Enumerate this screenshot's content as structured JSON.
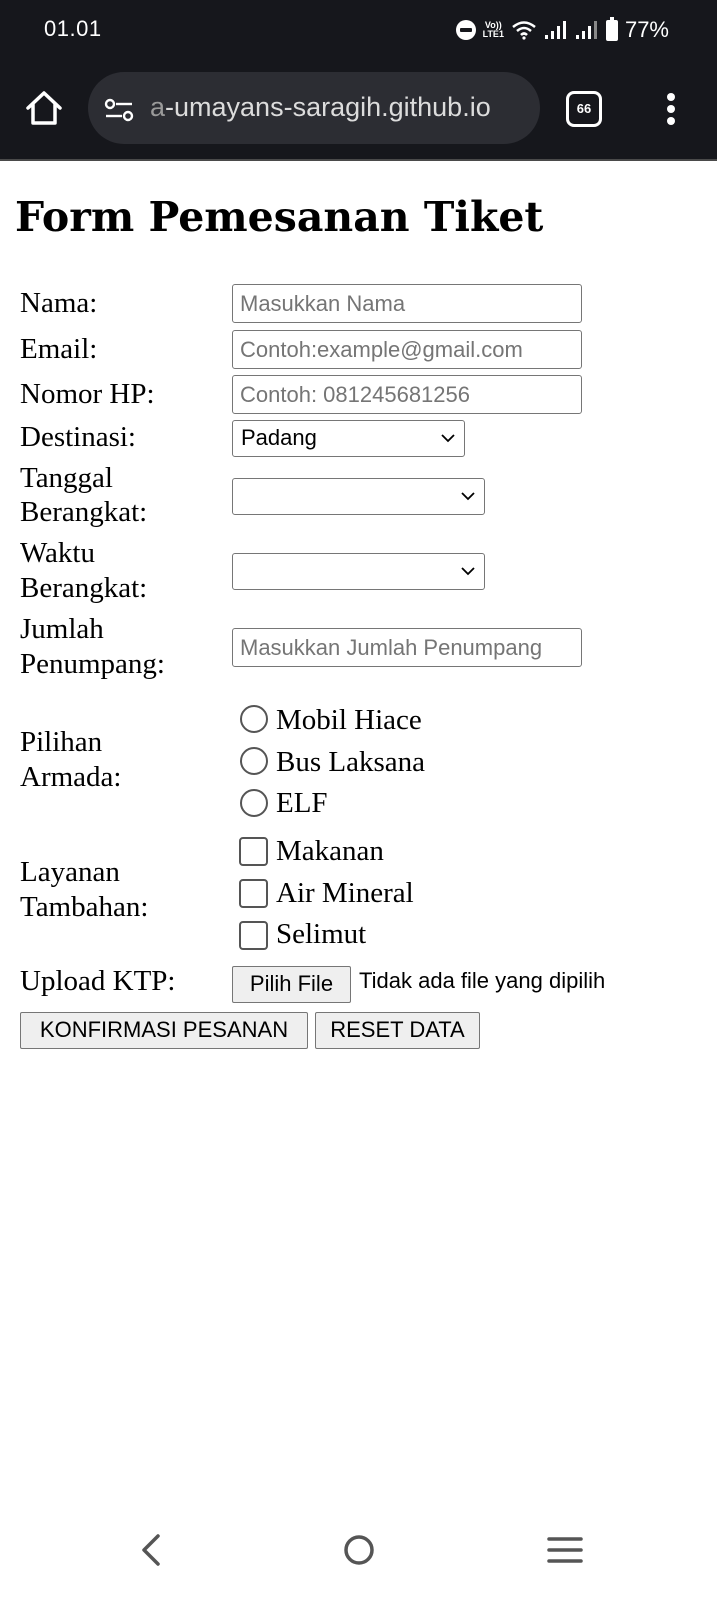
{
  "status_bar": {
    "time": "01.01",
    "volte_line1": "Vo))",
    "volte_line2": "LTE1",
    "battery": "77%",
    "icons": [
      "do-not-disturb-icon",
      "volte-icon",
      "wifi-icon",
      "signal-icon",
      "signal-icon",
      "battery-icon"
    ]
  },
  "browser": {
    "url_faded": "a",
    "url_main": "-umayans-saragih.github.io",
    "tab_count": "66",
    "icons": [
      "home-icon",
      "site-settings-icon",
      "more-options-icon"
    ]
  },
  "form": {
    "title": "Form Pemesanan Tiket",
    "labels": {
      "nama": "Nama:",
      "email": "Email:",
      "nomor_hp": "Nomor HP:",
      "destinasi": "Destinasi:",
      "tanggal_1": "Tanggal",
      "tanggal_2": "Berangkat:",
      "waktu_1": "Waktu",
      "waktu_2": "Berangkat:",
      "jumlah_1": "Jumlah",
      "jumlah_2": "Penumpang:",
      "armada_1": "Pilihan",
      "armada_2": "Armada:",
      "layanan_1": "Layanan",
      "layanan_2": "Tambahan:",
      "upload": "Upload KTP:"
    },
    "placeholders": {
      "nama": "Masukkan Nama",
      "email": "Contoh:example@gmail.com",
      "nomor_hp": "Contoh: 081245681256",
      "jumlah": "Masukkan Jumlah Penumpang"
    },
    "values": {
      "nama": "",
      "email": "",
      "nomor_hp": "",
      "jumlah": ""
    },
    "destinasi_selected": "Padang",
    "tanggal_selected": "",
    "waktu_selected": "",
    "armada_options": [
      "Mobil Hiace",
      "Bus Laksana",
      "ELF"
    ],
    "armada_selected": null,
    "layanan_options": [
      "Makanan",
      "Air Mineral",
      "Selimut"
    ],
    "layanan_checked": [
      false,
      false,
      false
    ],
    "file_button": "Pilih File",
    "file_status": "Tidak ada file yang dipilih",
    "submit_button": "KONFIRMASI PESANAN",
    "reset_button": "RESET DATA"
  },
  "nav_bar": {
    "icons": [
      "back-icon",
      "home-icon",
      "recent-apps-icon"
    ]
  }
}
